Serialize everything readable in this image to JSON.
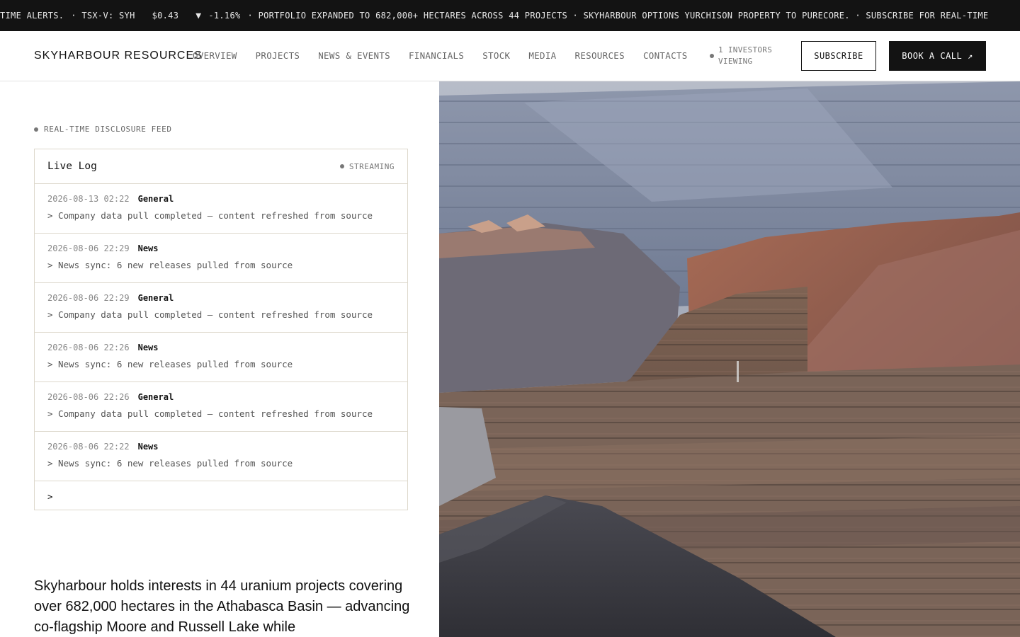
{
  "ticker": {
    "lead": "TIME ALERTS.",
    "symbol": "· TSX-V: SYH",
    "price": "$0.43",
    "change": "-1.16%",
    "headlines": "· PORTFOLIO EXPANDED TO 682,000+ HECTARES ACROSS 44 PROJECTS · SKYHARBOUR OPTIONS YURCHISON PROPERTY TO PURECORE. · SUBSCRIBE FOR REAL-TIME"
  },
  "header": {
    "brand": "SKYHARBOUR RESOURCES",
    "nav": [
      "OVERVIEW",
      "PROJECTS",
      "NEWS & EVENTS",
      "FINANCIALS",
      "STOCK",
      "MEDIA",
      "RESOURCES",
      "CONTACTS"
    ],
    "viewers": "1 INVESTORS VIEWING",
    "subscribe": "SUBSCRIBE",
    "book_call": "BOOK A CALL ↗"
  },
  "feed": {
    "label": "REAL-TIME DISCLOSURE FEED",
    "title": "Live Log",
    "status": "STREAMING",
    "entries": [
      {
        "time": "2026-08-13 02:22",
        "category": "General",
        "message": "> Company data pull completed — content refreshed from source"
      },
      {
        "time": "2026-08-06 22:29",
        "category": "News",
        "message": "> News sync: 6 new releases pulled from source"
      },
      {
        "time": "2026-08-06 22:29",
        "category": "General",
        "message": "> Company data pull completed — content refreshed from source"
      },
      {
        "time": "2026-08-06 22:26",
        "category": "News",
        "message": "> News sync: 6 new releases pulled from source"
      },
      {
        "time": "2026-08-06 22:26",
        "category": "General",
        "message": "> Company data pull completed — content refreshed from source"
      },
      {
        "time": "2026-08-06 22:22",
        "category": "News",
        "message": "> News sync: 6 new releases pulled from source"
      }
    ],
    "prompt": ">"
  },
  "intro": "Skyharbour holds interests in 44 uranium projects covering over 682,000 hectares in the Athabasca Basin — advancing co-flagship Moore and Russell Lake while",
  "colors": {
    "ticker_bg": "#131313",
    "button_dark": "#131313",
    "border": "#ddd8cc"
  }
}
